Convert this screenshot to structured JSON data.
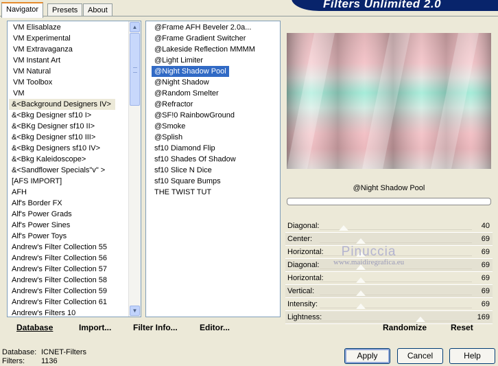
{
  "tabs": [
    "Navigator",
    "Presets",
    "About"
  ],
  "active_tab": "Navigator",
  "banner_title": "Filters Unlimited 2.0",
  "categories": [
    "VM Elisablaze",
    "VM Experimental",
    "VM Extravaganza",
    "VM Instant Art",
    "VM Natural",
    "VM Toolbox",
    "VM",
    "&<Background Designers IV>",
    "&<Bkg Designer sf10 I>",
    "&<BKg Designer sf10 II>",
    "&<Bkg Designer sf10 III>",
    "&<Bkg Designers sf10 IV>",
    "&<Bkg Kaleidoscope>",
    "&<Sandflower Specials\"v\" >",
    "[AFS IMPORT]",
    "AFH",
    "Alf's Border FX",
    "Alf's Power Grads",
    "Alf's Power Sines",
    "Alf's Power Toys",
    "Andrew's Filter Collection 55",
    "Andrew's Filter Collection 56",
    "Andrew's Filter Collection 57",
    "Andrew's Filter Collection 58",
    "Andrew's Filter Collection 59",
    "Andrew's Filter Collection 61",
    "Andrew's Filters 10"
  ],
  "selected_category": "&<Background Designers IV>",
  "filters": [
    "@Frame AFH Beveler 2.0a...",
    "@Frame Gradient Switcher",
    "@Lakeside Reflection MMMM",
    "@Light Limiter",
    "@Night Shadow Pool",
    "@Night Shadow",
    "@Random Smelter",
    "@Refractor",
    "@SF!0 RainbowGround",
    "@Smoke",
    "@Splish",
    "sf10 Diamond Flip",
    "sf10 Shades Of Shadow",
    "sf10 Slice N Dice",
    "sf10 Square Bumps",
    "THE TWIST TUT"
  ],
  "selected_filter": "@Night Shadow Pool",
  "preview_label": "@Night Shadow Pool",
  "parameters": [
    {
      "label": "Diagonal:",
      "value": "40"
    },
    {
      "label": "Center:",
      "value": "69"
    },
    {
      "label": "Horizontal:",
      "value": "69"
    },
    {
      "label": "Diagonal:",
      "value": "69"
    },
    {
      "label": "Horizontal:",
      "value": "69"
    },
    {
      "label": "Vertical:",
      "value": "69"
    },
    {
      "label": "Intensity:",
      "value": "69"
    },
    {
      "label": "Lightness:",
      "value": "169"
    }
  ],
  "watermark": {
    "line1": "Pinuccia",
    "line2": "www.maidiregrafica.eu"
  },
  "actions": {
    "database": "Database",
    "import": "Import...",
    "filter_info": "Filter Info...",
    "editor": "Editor...",
    "randomize": "Randomize",
    "reset": "Reset"
  },
  "info": {
    "database_label": "Database:",
    "database_value": "ICNET-Filters",
    "filters_label": "Filters:",
    "filters_value": "1136"
  },
  "buttons": {
    "apply": "Apply",
    "cancel": "Cancel",
    "help": "Help"
  },
  "colors": {
    "selection": "#316ac5",
    "banner": "#08246b",
    "tab_accent": "#e68b2c"
  }
}
